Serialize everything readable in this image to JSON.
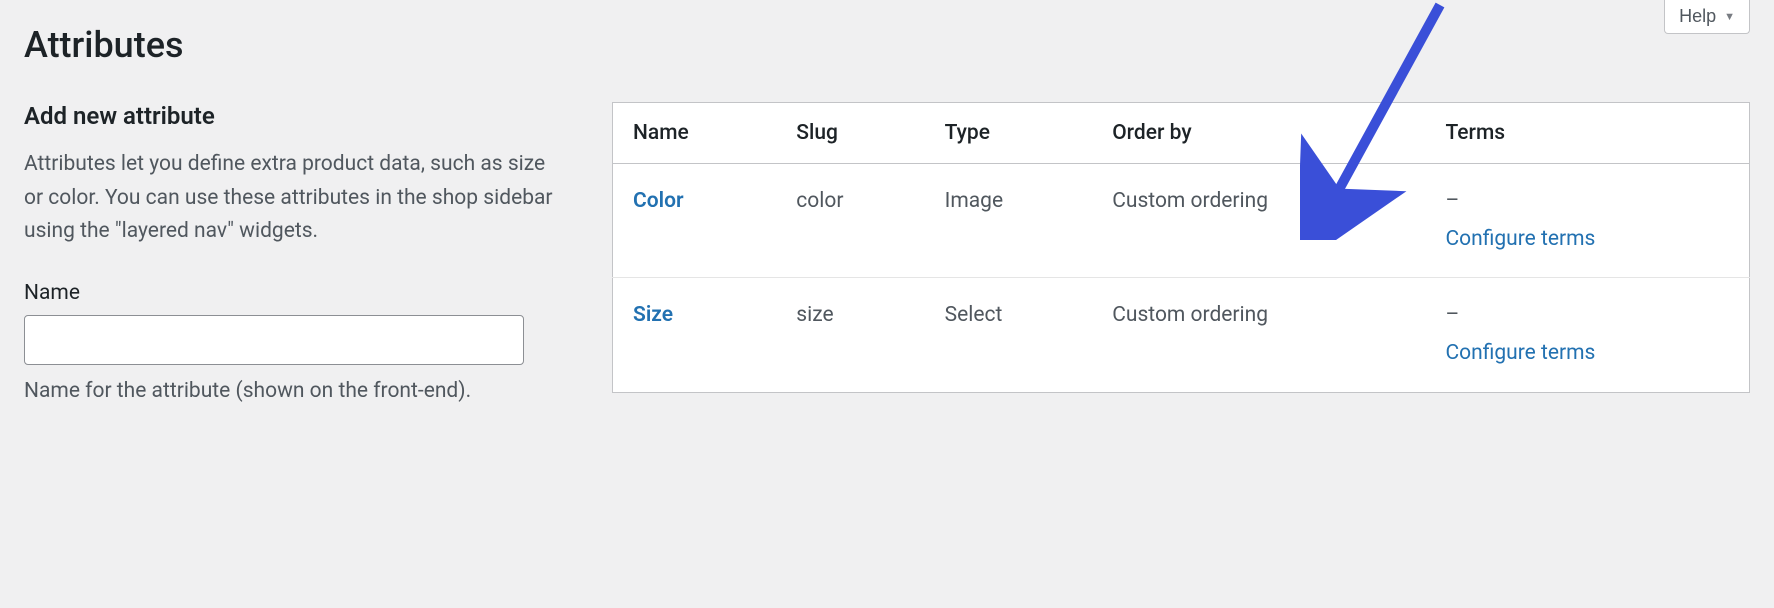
{
  "help_button": {
    "label": "Help"
  },
  "page_title": "Attributes",
  "form": {
    "heading": "Add new attribute",
    "description": "Attributes let you define extra product data, such as size or color. You can use these attributes in the shop sidebar using the \"layered nav\" widgets.",
    "name_label": "Name",
    "name_value": "",
    "name_help": "Name for the attribute (shown on the front-end)."
  },
  "table": {
    "headers": {
      "name": "Name",
      "slug": "Slug",
      "type": "Type",
      "order_by": "Order by",
      "terms": "Terms"
    },
    "rows": [
      {
        "name": "Color",
        "slug": "color",
        "type": "Image",
        "order_by": "Custom ordering",
        "terms_placeholder": "–",
        "configure_label": "Configure terms"
      },
      {
        "name": "Size",
        "slug": "size",
        "type": "Select",
        "order_by": "Custom ordering",
        "terms_placeholder": "–",
        "configure_label": "Configure terms"
      }
    ]
  }
}
